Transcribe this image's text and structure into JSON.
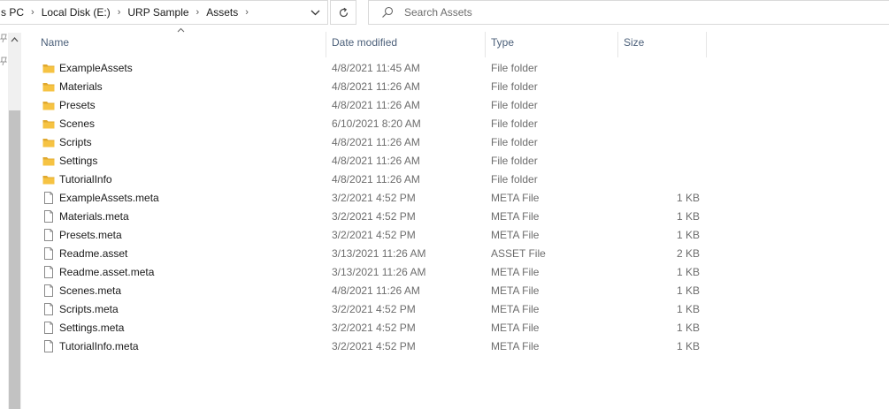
{
  "address_bar": {
    "crumbs": [
      "s PC",
      "Local Disk (E:)",
      "URP Sample",
      "Assets"
    ]
  },
  "search": {
    "placeholder": "Search Assets"
  },
  "columns": {
    "name": "Name",
    "date": "Date modified",
    "type": "Type",
    "size": "Size"
  },
  "files": [
    {
      "name": "ExampleAssets",
      "date": "4/8/2021 11:45 AM",
      "type": "File folder",
      "size": "",
      "icon": "folder-icon"
    },
    {
      "name": "Materials",
      "date": "4/8/2021 11:26 AM",
      "type": "File folder",
      "size": "",
      "icon": "folder-icon"
    },
    {
      "name": "Presets",
      "date": "4/8/2021 11:26 AM",
      "type": "File folder",
      "size": "",
      "icon": "folder-icon"
    },
    {
      "name": "Scenes",
      "date": "6/10/2021 8:20 AM",
      "type": "File folder",
      "size": "",
      "icon": "folder-icon"
    },
    {
      "name": "Scripts",
      "date": "4/8/2021 11:26 AM",
      "type": "File folder",
      "size": "",
      "icon": "folder-icon"
    },
    {
      "name": "Settings",
      "date": "4/8/2021 11:26 AM",
      "type": "File folder",
      "size": "",
      "icon": "folder-icon"
    },
    {
      "name": "TutorialInfo",
      "date": "4/8/2021 11:26 AM",
      "type": "File folder",
      "size": "",
      "icon": "folder-icon"
    },
    {
      "name": "ExampleAssets.meta",
      "date": "3/2/2021 4:52 PM",
      "type": "META File",
      "size": "1 KB",
      "icon": "file-icon"
    },
    {
      "name": "Materials.meta",
      "date": "3/2/2021 4:52 PM",
      "type": "META File",
      "size": "1 KB",
      "icon": "file-icon"
    },
    {
      "name": "Presets.meta",
      "date": "3/2/2021 4:52 PM",
      "type": "META File",
      "size": "1 KB",
      "icon": "file-icon"
    },
    {
      "name": "Readme.asset",
      "date": "3/13/2021 11:26 AM",
      "type": "ASSET File",
      "size": "2 KB",
      "icon": "file-icon"
    },
    {
      "name": "Readme.asset.meta",
      "date": "3/13/2021 11:26 AM",
      "type": "META File",
      "size": "1 KB",
      "icon": "file-icon"
    },
    {
      "name": "Scenes.meta",
      "date": "4/8/2021 11:26 AM",
      "type": "META File",
      "size": "1 KB",
      "icon": "file-icon"
    },
    {
      "name": "Scripts.meta",
      "date": "3/2/2021 4:52 PM",
      "type": "META File",
      "size": "1 KB",
      "icon": "file-icon"
    },
    {
      "name": "Settings.meta",
      "date": "3/2/2021 4:52 PM",
      "type": "META File",
      "size": "1 KB",
      "icon": "file-icon"
    },
    {
      "name": "TutorialInfo.meta",
      "date": "3/2/2021 4:52 PM",
      "type": "META File",
      "size": "1 KB",
      "icon": "file-icon"
    }
  ],
  "colors": {
    "folder": "#f6c343",
    "folder_dark": "#e0a82e",
    "header_text": "#4c607a",
    "secondary_text": "#6d6d6d"
  }
}
